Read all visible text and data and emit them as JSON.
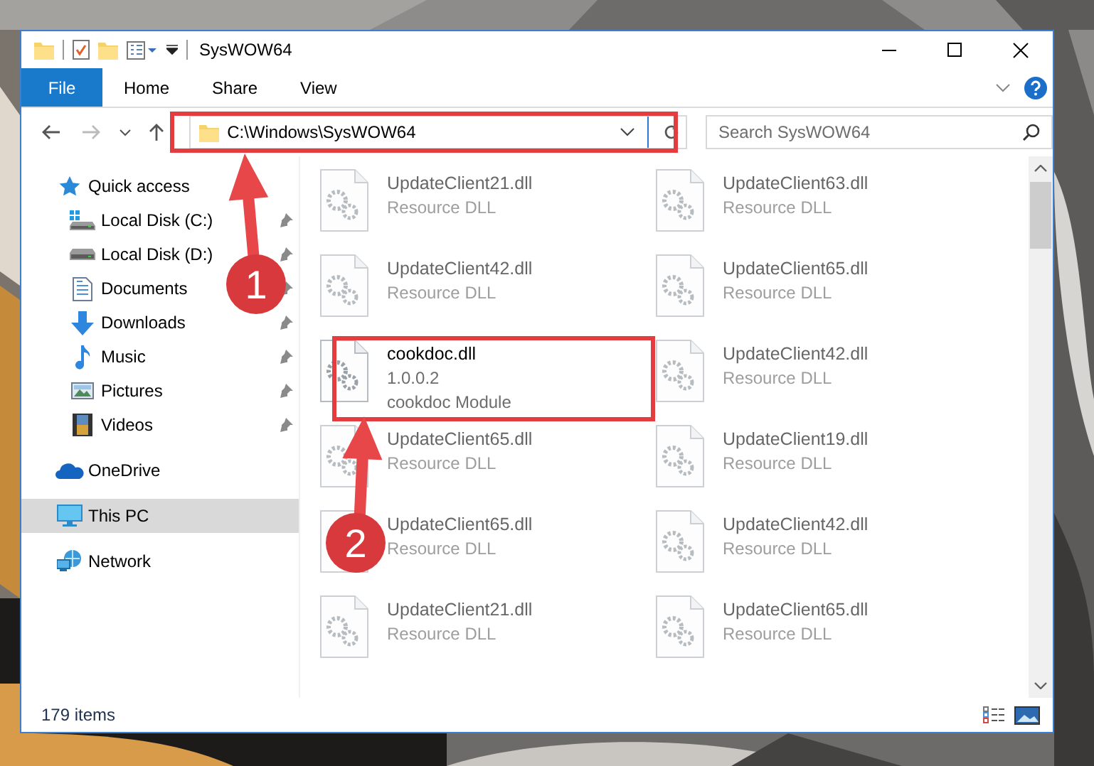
{
  "window": {
    "title": "SysWOW64"
  },
  "ribbon": {
    "tabs": [
      {
        "label": "File",
        "kind": "file"
      },
      {
        "label": "Home",
        "kind": "tab"
      },
      {
        "label": "Share",
        "kind": "tab"
      },
      {
        "label": "View",
        "kind": "tab"
      }
    ]
  },
  "address_bar": {
    "path": "C:\\Windows\\SysWOW64"
  },
  "search": {
    "placeholder": "Search SysWOW64"
  },
  "navigation": [
    {
      "label": "Quick access",
      "kind": "star",
      "selected": false,
      "children": [
        {
          "label": "Local Disk (C:)",
          "kind": "disk-c",
          "pinned": true,
          "selected": false
        },
        {
          "label": "Local Disk (D:)",
          "kind": "disk",
          "pinned": true,
          "selected": false
        },
        {
          "label": "Documents",
          "kind": "documents",
          "pinned": true,
          "selected": false
        },
        {
          "label": "Downloads",
          "kind": "downloads",
          "pinned": true,
          "selected": false
        },
        {
          "label": "Music",
          "kind": "music",
          "pinned": true,
          "selected": false
        },
        {
          "label": "Pictures",
          "kind": "pictures",
          "pinned": true,
          "selected": false
        },
        {
          "label": "Videos",
          "kind": "videos",
          "pinned": true,
          "selected": false
        }
      ]
    },
    {
      "label": "OneDrive",
      "kind": "cloud",
      "selected": false
    },
    {
      "label": "This PC",
      "kind": "pc",
      "selected": true
    },
    {
      "label": "Network",
      "kind": "network",
      "selected": false
    }
  ],
  "files": [
    {
      "name": "UpdateClient21.dll",
      "details": [
        "Resource DLL"
      ],
      "blurred": true
    },
    {
      "name": "UpdateClient63.dll",
      "details": [
        "Resource DLL"
      ],
      "blurred": true
    },
    {
      "name": "UpdateClient42.dll",
      "details": [
        "Resource DLL"
      ],
      "blurred": true
    },
    {
      "name": "UpdateClient65.dll",
      "details": [
        "Resource DLL"
      ],
      "blurred": true
    },
    {
      "name": "cookdoc.dll",
      "details": [
        "1.0.0.2",
        "cookdoc Module"
      ],
      "blurred": false
    },
    {
      "name": "UpdateClient42.dll",
      "details": [
        "Resource DLL"
      ],
      "blurred": true
    },
    {
      "name": "UpdateClient65.dll",
      "details": [
        "Resource DLL"
      ],
      "blurred": true
    },
    {
      "name": "UpdateClient19.dll",
      "details": [
        "Resource DLL"
      ],
      "blurred": true
    },
    {
      "name": "UpdateClient65.dll",
      "details": [
        "Resource DLL"
      ],
      "blurred": true
    },
    {
      "name": "UpdateClient42.dll",
      "details": [
        "Resource DLL"
      ],
      "blurred": true
    },
    {
      "name": "UpdateClient21.dll",
      "details": [
        "Resource DLL"
      ],
      "blurred": true
    },
    {
      "name": "UpdateClient65.dll",
      "details": [
        "Resource DLL"
      ],
      "blurred": true
    }
  ],
  "status_bar": {
    "item_count": "179 items"
  },
  "annotations": [
    {
      "number": "1"
    },
    {
      "number": "2"
    }
  ]
}
